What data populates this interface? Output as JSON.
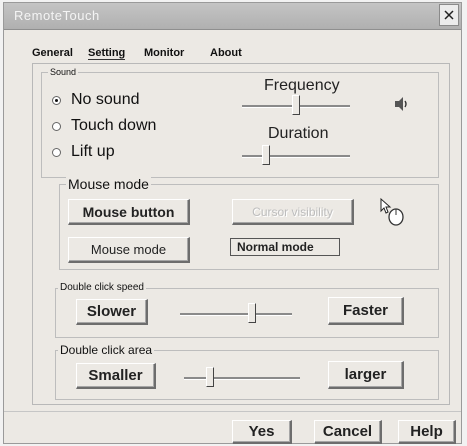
{
  "window": {
    "title": "RemoteTouch"
  },
  "tabs": [
    {
      "label": "General"
    },
    {
      "label": "Setting"
    },
    {
      "label": "Monitor"
    },
    {
      "label": "About"
    }
  ],
  "sound": {
    "group_label": "Sound",
    "options": [
      {
        "label": "No sound",
        "selected": true
      },
      {
        "label": "Touch down",
        "selected": false
      },
      {
        "label": "Lift up",
        "selected": false
      }
    ],
    "frequency_label": "Frequency",
    "duration_label": "Duration",
    "frequency_value": 0.5,
    "duration_value": 0.2,
    "icon": "speaker-icon"
  },
  "mouse_mode": {
    "group_label": "Mouse mode",
    "mouse_button_label": "Mouse button",
    "mouse_mode_label": "Mouse mode",
    "cursor_visibility_label": "Cursor visibility",
    "status_label": "Normal mode",
    "icon": "mouse-pointer-icon"
  },
  "double_click_speed": {
    "group_label": "Double click speed",
    "slower_label": "Slower",
    "faster_label": "Faster",
    "value": 0.65
  },
  "double_click_area": {
    "group_label": "Double click area",
    "smaller_label": "Smaller",
    "larger_label": "larger",
    "value": 0.2
  },
  "footer": {
    "yes_label": "Yes",
    "cancel_label": "Cancel",
    "help_label": "Help"
  },
  "colors": {
    "title_bar": "#b8b8b8",
    "dialog_bg": "#ece9e4"
  }
}
